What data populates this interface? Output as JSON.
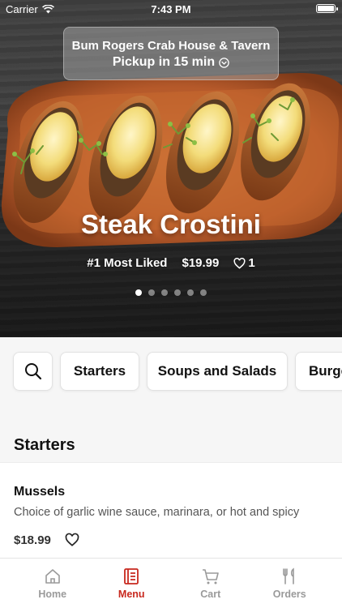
{
  "status_bar": {
    "carrier": "Carrier",
    "time": "7:43 PM"
  },
  "pickup_banner": {
    "restaurant": "Bum Rogers Crab House & Tavern",
    "eta": "Pickup in 15 min"
  },
  "featured": {
    "title": "Steak Crostini",
    "badge": "#1 Most Liked",
    "price": "$19.99",
    "likes": "1",
    "carousel_total": 6,
    "carousel_active": 1
  },
  "categories": [
    "Starters",
    "Soups and Salads",
    "Burgers"
  ],
  "section": {
    "title": "Starters",
    "items": [
      {
        "name": "Mussels",
        "description": "Choice of garlic wine sauce, marinara, or hot and spicy",
        "price": "$18.99"
      }
    ]
  },
  "tabbar": {
    "tabs": [
      {
        "label": "Home",
        "icon": "home-icon"
      },
      {
        "label": "Menu",
        "icon": "menu-icon"
      },
      {
        "label": "Cart",
        "icon": "cart-icon"
      },
      {
        "label": "Orders",
        "icon": "orders-icon"
      }
    ],
    "active": "Menu"
  },
  "colors": {
    "accent": "#c8281e",
    "inactive_tab": "#9a9a9a",
    "background": "#f6f6f6"
  }
}
